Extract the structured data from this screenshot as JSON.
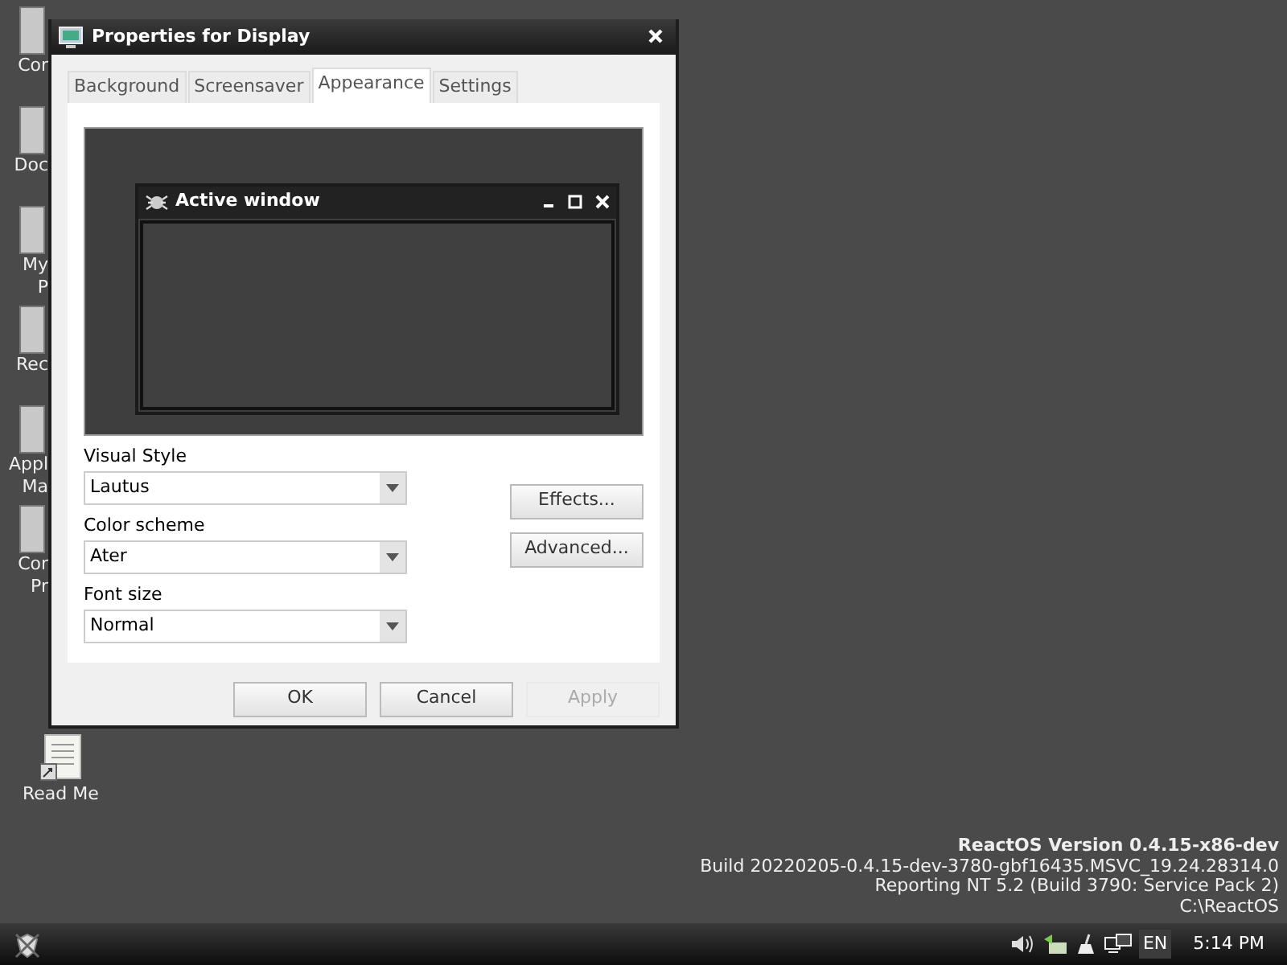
{
  "desktop_icons": [
    {
      "label_lines": [
        "Cor"
      ]
    },
    {
      "label_lines": [
        "Doc"
      ]
    },
    {
      "label_lines": [
        "My",
        "P"
      ]
    },
    {
      "label_lines": [
        "Rec"
      ]
    },
    {
      "label_lines": [
        "Appl",
        "Ma"
      ]
    },
    {
      "label_lines": [
        "Cor",
        "Pr"
      ]
    },
    {
      "label_lines": [
        "Read Me"
      ]
    }
  ],
  "window": {
    "title": "Properties for Display",
    "tabs": [
      {
        "label": "Background",
        "selected": false
      },
      {
        "label": "Screensaver",
        "selected": false
      },
      {
        "label": "Appearance",
        "selected": true
      },
      {
        "label": "Settings",
        "selected": false
      }
    ],
    "preview": {
      "title": "Active window"
    },
    "fields": [
      {
        "label": "Visual Style",
        "value": "Lautus"
      },
      {
        "label": "Color scheme",
        "value": "Ater"
      },
      {
        "label": "Font size",
        "value": "Normal"
      }
    ],
    "side_buttons": [
      "Effects...",
      "Advanced..."
    ],
    "buttons": [
      {
        "label": "OK",
        "disabled": false
      },
      {
        "label": "Cancel",
        "disabled": false
      },
      {
        "label": "Apply",
        "disabled": true
      }
    ]
  },
  "version_info": [
    {
      "text": "ReactOS Version 0.4.15-x86-dev",
      "bold": true
    },
    {
      "text": "Build 20220205-0.4.15-dev-3780-gbf16435.MSVC_19.24.28314.0",
      "bold": false
    },
    {
      "text": "Reporting NT 5.2 (Build 3790: Service Pack 2)",
      "bold": false
    },
    {
      "text": "C:\\ReactOS",
      "bold": false
    }
  ],
  "taskbar": {
    "language": "EN",
    "clock": "5:14 PM"
  }
}
